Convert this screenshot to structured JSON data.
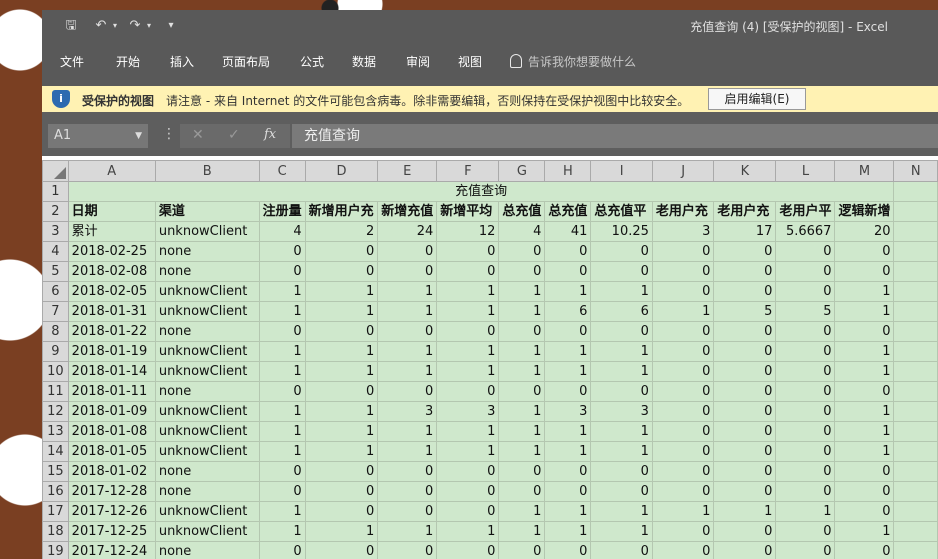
{
  "window": {
    "title": "充值查询 (4)  [受保护的视图]  -  Excel",
    "quick_access": [
      "save-icon",
      "undo-icon",
      "redo-icon",
      "customize-icon"
    ]
  },
  "ribbon": {
    "tabs": [
      "文件",
      "开始",
      "插入",
      "页面布局",
      "公式",
      "数据",
      "审阅",
      "视图"
    ],
    "tell_me": "告诉我你想要做什么"
  },
  "protected_view": {
    "title": "受保护的视图",
    "message": "请注意 - 来自 Internet 的文件可能包含病毒。除非需要编辑，否则保持在受保护视图中比较安全。",
    "enable_button": "启用编辑(E)"
  },
  "formula_bar": {
    "name_box": "A1",
    "fx": "fx",
    "formula": "充值查询"
  },
  "sheet": {
    "columns": [
      "A",
      "B",
      "C",
      "D",
      "E",
      "F",
      "G",
      "H",
      "I",
      "J",
      "K",
      "L",
      "M",
      "N"
    ],
    "title": "充值查询",
    "headers": [
      "日期",
      "渠道",
      "注册量",
      "新增用户充",
      "新增充值",
      "新增平均",
      "总充值",
      "总充值",
      "总充值平",
      "老用户充",
      "老用户充",
      "老用户平",
      "逻辑新增"
    ],
    "summary": [
      "累计",
      "unknowClient",
      "4",
      "2",
      "24",
      "12",
      "4",
      "41",
      "10.25",
      "3",
      "17",
      "5.6667",
      "20"
    ],
    "rows": [
      {
        "n": "4",
        "cells": [
          "2018-02-25",
          "none",
          "0",
          "0",
          "0",
          "0",
          "0",
          "0",
          "0",
          "0",
          "0",
          "0",
          "0"
        ]
      },
      {
        "n": "5",
        "cells": [
          "2018-02-08",
          "none",
          "0",
          "0",
          "0",
          "0",
          "0",
          "0",
          "0",
          "0",
          "0",
          "0",
          "0"
        ]
      },
      {
        "n": "6",
        "cells": [
          "2018-02-05",
          "unknowClient",
          "1",
          "1",
          "1",
          "1",
          "1",
          "1",
          "1",
          "0",
          "0",
          "0",
          "1"
        ]
      },
      {
        "n": "7",
        "cells": [
          "2018-01-31",
          "unknowClient",
          "1",
          "1",
          "1",
          "1",
          "1",
          "6",
          "6",
          "1",
          "5",
          "5",
          "1"
        ]
      },
      {
        "n": "8",
        "cells": [
          "2018-01-22",
          "none",
          "0",
          "0",
          "0",
          "0",
          "0",
          "0",
          "0",
          "0",
          "0",
          "0",
          "0"
        ]
      },
      {
        "n": "9",
        "cells": [
          "2018-01-19",
          "unknowClient",
          "1",
          "1",
          "1",
          "1",
          "1",
          "1",
          "1",
          "0",
          "0",
          "0",
          "1"
        ]
      },
      {
        "n": "10",
        "cells": [
          "2018-01-14",
          "unknowClient",
          "1",
          "1",
          "1",
          "1",
          "1",
          "1",
          "1",
          "0",
          "0",
          "0",
          "1"
        ]
      },
      {
        "n": "11",
        "cells": [
          "2018-01-11",
          "none",
          "0",
          "0",
          "0",
          "0",
          "0",
          "0",
          "0",
          "0",
          "0",
          "0",
          "0"
        ]
      },
      {
        "n": "12",
        "cells": [
          "2018-01-09",
          "unknowClient",
          "1",
          "1",
          "3",
          "3",
          "1",
          "3",
          "3",
          "0",
          "0",
          "0",
          "1"
        ]
      },
      {
        "n": "13",
        "cells": [
          "2018-01-08",
          "unknowClient",
          "1",
          "1",
          "1",
          "1",
          "1",
          "1",
          "1",
          "0",
          "0",
          "0",
          "1"
        ]
      },
      {
        "n": "14",
        "cells": [
          "2018-01-05",
          "unknowClient",
          "1",
          "1",
          "1",
          "1",
          "1",
          "1",
          "1",
          "0",
          "0",
          "0",
          "1"
        ]
      },
      {
        "n": "15",
        "cells": [
          "2018-01-02",
          "none",
          "0",
          "0",
          "0",
          "0",
          "0",
          "0",
          "0",
          "0",
          "0",
          "0",
          "0"
        ]
      },
      {
        "n": "16",
        "cells": [
          "2017-12-28",
          "none",
          "0",
          "0",
          "0",
          "0",
          "0",
          "0",
          "0",
          "0",
          "0",
          "0",
          "0"
        ]
      },
      {
        "n": "17",
        "cells": [
          "2017-12-26",
          "unknowClient",
          "1",
          "0",
          "0",
          "0",
          "1",
          "1",
          "1",
          "1",
          "1",
          "1",
          "0"
        ]
      },
      {
        "n": "18",
        "cells": [
          "2017-12-25",
          "unknowClient",
          "1",
          "1",
          "1",
          "1",
          "1",
          "1",
          "1",
          "0",
          "0",
          "0",
          "1"
        ]
      },
      {
        "n": "19",
        "cells": [
          "2017-12-24",
          "none",
          "0",
          "0",
          "0",
          "0",
          "0",
          "0",
          "0",
          "0",
          "0",
          "0",
          "0"
        ]
      }
    ]
  }
}
